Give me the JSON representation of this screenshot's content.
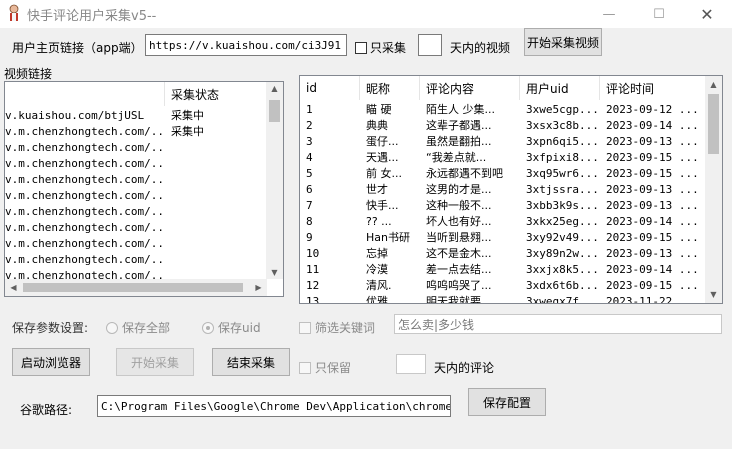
{
  "window": {
    "title": "快手评论用户采集v5--",
    "minimize_icon": "minimize-icon",
    "maximize_icon": "maximize-icon",
    "close_icon": "close-icon"
  },
  "top": {
    "url_label": "用户主页链接（app端）",
    "url_value": "https://v.kuaishou.com/ci3J91",
    "only_collect_label": "只采集",
    "days_value": "",
    "days_label": "天内的视频",
    "start_video_button": "开始采集视频"
  },
  "video_list": {
    "group_label": "视频链接",
    "columns": [
      "",
      "采集状态"
    ],
    "rows": [
      [
        "v.kuaishou.com/btjUSL",
        "采集中"
      ],
      [
        "v.m.chenzhongtech.com/...",
        "采集中"
      ],
      [
        "v.m.chenzhongtech.com/...",
        ""
      ],
      [
        "v.m.chenzhongtech.com/...",
        ""
      ],
      [
        "v.m.chenzhongtech.com/...",
        ""
      ],
      [
        "v.m.chenzhongtech.com/...",
        ""
      ],
      [
        "v.m.chenzhongtech.com/...",
        ""
      ],
      [
        "v.m.chenzhongtech.com/...",
        ""
      ],
      [
        "v.m.chenzhongtech.com/...",
        ""
      ],
      [
        "v.m.chenzhongtech.com/...",
        ""
      ],
      [
        "v.m.chenzhongtech.com/...",
        ""
      ]
    ]
  },
  "comment_table": {
    "columns": [
      "id",
      "昵称",
      "评论内容",
      "用户uid",
      "评论时间"
    ],
    "rows": [
      [
        "1",
        "瞄 硬",
        "陌生人 少集...",
        "3xwe5cgp...",
        "2023-09-12 ..."
      ],
      [
        "2",
        "典典",
        "这辈子都遇...",
        "3xsx3c8b...",
        "2023-09-14 ..."
      ],
      [
        "3",
        "蛋仔...",
        "虽然是翻拍...",
        "3xpn6qi5...",
        "2023-09-13 ..."
      ],
      [
        "4",
        "天遇...",
        "“我差点就...",
        "3xfpixi8...",
        "2023-09-15 ..."
      ],
      [
        "5",
        "前 女...",
        "永远都遇不到吧",
        "3xq95wr6...",
        "2023-09-15 ..."
      ],
      [
        "6",
        "世才",
        "这男的才是...",
        "3xtjssra...",
        "2023-09-13 ..."
      ],
      [
        "7",
        "快手...",
        "这种一般不...",
        "3xbb3k9s...",
        "2023-09-13 ..."
      ],
      [
        "8",
        "?? ...",
        "坏人也有好...",
        "3xkx25eg...",
        "2023-09-14 ..."
      ],
      [
        "9",
        "Han书研",
        "当听到悬翙...",
        "3xy92v49...",
        "2023-09-15 ..."
      ],
      [
        "10",
        "忘掉",
        "这不是金木...",
        "3xy89n2w...",
        "2023-09-13 ..."
      ],
      [
        "11",
        "冷漠",
        "差一点去结...",
        "3xxjx8k5...",
        "2023-09-14 ..."
      ],
      [
        "12",
        "清风.",
        "呜呜呜哭了...",
        "3xdx6t6b...",
        "2023-09-15 ..."
      ],
      [
        "13",
        "优雅...",
        "明天我就要...",
        "3xwegx7f...",
        "2023-11-22 ..."
      ]
    ]
  },
  "params": {
    "save_label": "保存参数设置:",
    "save_all": "保存全部",
    "save_uid": "保存uid",
    "filter_keyword": "筛选关键词",
    "keyword_value": "怎么卖|多少钱"
  },
  "actions": {
    "launch_browser": "启动浏览器",
    "start_collect": "开始采集",
    "end_collect": "结束采集",
    "only_keep": "只保留",
    "keep_days_value": "",
    "keep_days_label": "天内的评论"
  },
  "chrome": {
    "path_label": "谷歌路径:",
    "path_value": "C:\\Program Files\\Google\\Chrome Dev\\Application\\chrome.exe\"",
    "save_config": "保存配置"
  }
}
